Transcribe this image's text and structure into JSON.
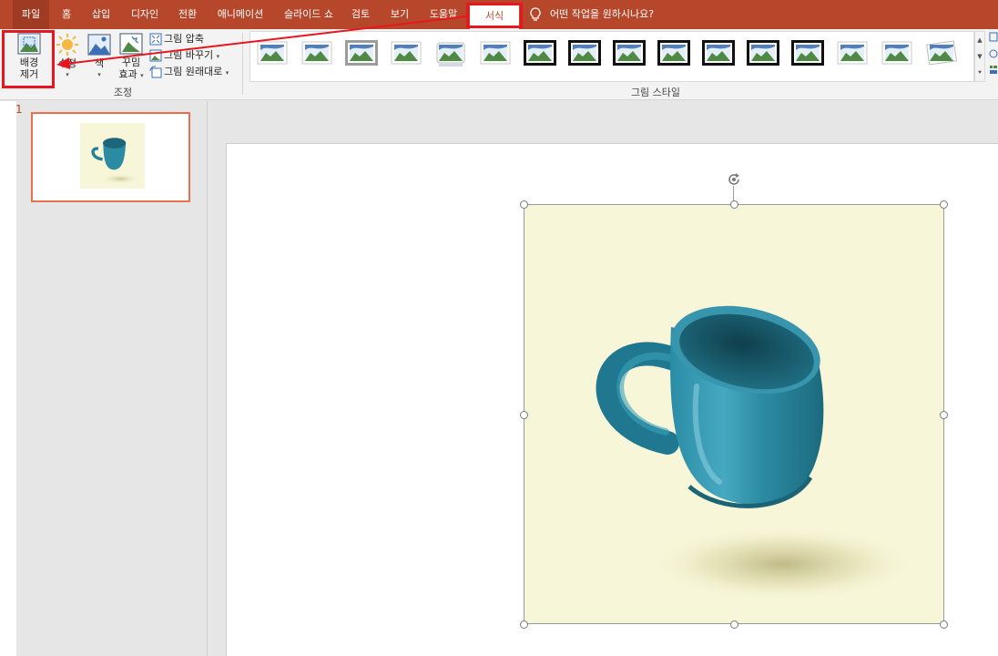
{
  "menu": {
    "tabs": [
      {
        "label": "파일",
        "type": "file"
      },
      {
        "label": "홈"
      },
      {
        "label": "삽입"
      },
      {
        "label": "디자인"
      },
      {
        "label": "전환"
      },
      {
        "label": "애니메이션"
      },
      {
        "label": "슬라이드 쇼"
      },
      {
        "label": "검토"
      },
      {
        "label": "보기"
      },
      {
        "label": "도움말"
      },
      {
        "label": "서식",
        "active": true
      }
    ],
    "tell_me": "어떤 작업을 원하시나요?",
    "bar_color": "#b7472a"
  },
  "ribbon": {
    "remove_background": {
      "line1": "배경",
      "line2": "제거"
    },
    "corrections": "수정",
    "color": "색",
    "artistic_effects": {
      "line1": "꾸밈",
      "line2": "효과"
    },
    "compress": "그림 압축",
    "change_picture": "그림 바꾸기",
    "reset_picture": "그림 원래대로",
    "adjust_group_label": "조정",
    "styles_group_label": "그림 스타일",
    "picture_styles": [
      "simple-frame-white",
      "beveled-matte-white",
      "metal-frame",
      "drop-shadow-rectangle",
      "reflected-rounded-rectangle",
      "soft-edge-rectangle",
      "double-frame-black",
      "thick-matte-black",
      "simple-frame-black",
      "simple-frame-black",
      "simple-frame-black",
      "compound-frame-black",
      "moderate-frame-black",
      "rounded-diagonal-corner-white",
      "snip-diagonal-corner-white",
      "rotated-white"
    ]
  },
  "slides": {
    "current_number": "1"
  },
  "annotation": {
    "highlight_color": "#e8161e",
    "thumb_border": "#e8704e"
  },
  "picture": {
    "subject": "teal-coffee-mug",
    "background_color": "#f7f6d9",
    "mug_color": "#2b8ba3"
  }
}
